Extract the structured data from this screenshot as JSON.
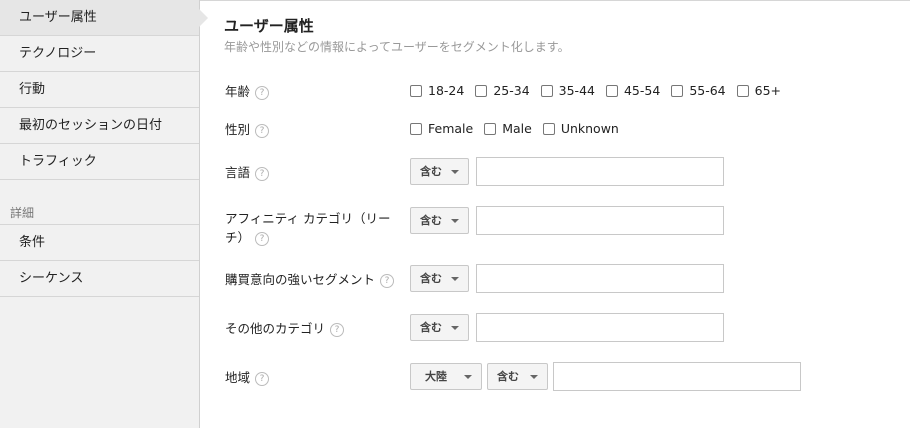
{
  "sidebar": {
    "items": [
      {
        "label": "ユーザー属性"
      },
      {
        "label": "テクノロジー"
      },
      {
        "label": "行動"
      },
      {
        "label": "最初のセッションの日付"
      },
      {
        "label": "トラフィック"
      }
    ],
    "section_label": "詳細",
    "detail_items": [
      {
        "label": "条件"
      },
      {
        "label": "シーケンス"
      }
    ]
  },
  "main": {
    "title": "ユーザー属性",
    "subtitle": "年齢や性別などの情報によってユーザーをセグメント化します。",
    "help_glyph": "?",
    "age": {
      "label": "年齢",
      "options": [
        "18-24",
        "25-34",
        "35-44",
        "45-54",
        "55-64",
        "65+"
      ]
    },
    "gender": {
      "label": "性別",
      "options": [
        "Female",
        "Male",
        "Unknown"
      ]
    },
    "language": {
      "label": "言語",
      "match": "含む",
      "value": ""
    },
    "affinity": {
      "label_line1": "アフィニティ カテゴリ（リー",
      "label_line2": "チ）",
      "match": "含む",
      "value": ""
    },
    "in_market": {
      "label": "購買意向の強いセグメント",
      "match": "含む",
      "value": ""
    },
    "other": {
      "label": "その他のカテゴリ",
      "match": "含む",
      "value": ""
    },
    "location": {
      "label": "地域",
      "scope": "大陸",
      "match": "含む",
      "value": ""
    }
  }
}
